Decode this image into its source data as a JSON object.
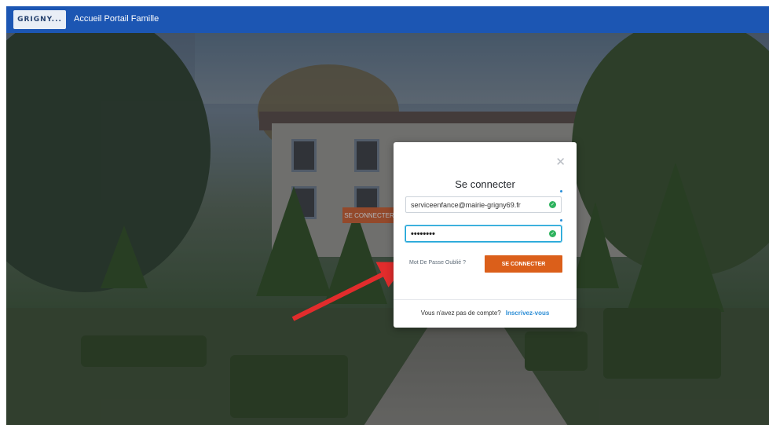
{
  "header": {
    "logo_text": "GRIGNY...",
    "nav_label": "Accueil Portail Famille"
  },
  "background": {
    "button_label": "SE CONNECTER"
  },
  "login_modal": {
    "title": "Se connecter",
    "close_icon": "close-icon",
    "email_value": "serviceenfance@mairie-grigny69.fr",
    "password_value": "••••••••",
    "forgot_label": "Mot De Passe Oublié ?",
    "submit_label": "SE CONNECTER",
    "no_account_text": "Vous n'avez pas de compte?",
    "register_label": "Inscrivez-vous"
  },
  "colors": {
    "brand_bar": "#1c56b3",
    "accent_button": "#db5f1a",
    "link": "#2f8fd6",
    "valid_check": "#2fb35f",
    "annotation_arrow": "#e22c2c"
  }
}
